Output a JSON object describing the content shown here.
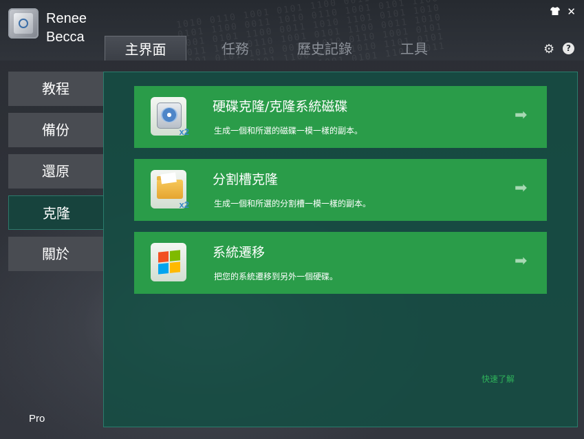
{
  "app": {
    "brand_line1": "Renee",
    "brand_line2": "Becca",
    "edition": "Pro"
  },
  "titlebar": {
    "skin_icon": "tshirt-icon",
    "close_icon": "close-icon",
    "settings_icon": "gear-icon",
    "help_label": "?"
  },
  "tabs": [
    {
      "label": "主界面",
      "active": true
    },
    {
      "label": "任務",
      "active": false
    },
    {
      "label": "歷史記錄",
      "active": false
    },
    {
      "label": "工具",
      "active": false
    }
  ],
  "sidebar": {
    "items": [
      {
        "label": "教程",
        "active": false
      },
      {
        "label": "備份",
        "active": false
      },
      {
        "label": "還原",
        "active": false
      },
      {
        "label": "克隆",
        "active": true
      },
      {
        "label": "關於",
        "active": false
      }
    ]
  },
  "cards": [
    {
      "title": "硬碟克隆/克隆系統磁碟",
      "description": "生成一個和所選的磁碟一模一樣的副本。",
      "icon": "disk-clone-icon",
      "badge": "x2"
    },
    {
      "title": "分割槽克隆",
      "description": "生成一個和所選的分割槽一模一樣的副本。",
      "icon": "partition-clone-icon",
      "badge": "x2"
    },
    {
      "title": "系統遷移",
      "description": "把您的系統遷移到另外一個硬碟。",
      "icon": "windows-logo-icon",
      "badge": ""
    }
  ],
  "quick_link": "快速了解",
  "colors": {
    "card_green": "#2a9c49",
    "panel_teal": "#144e44",
    "sidebar_gray": "#494c52",
    "accent_link": "#2fb35a"
  }
}
